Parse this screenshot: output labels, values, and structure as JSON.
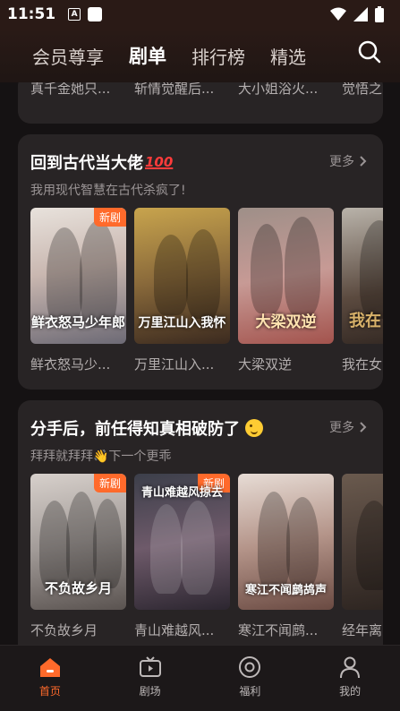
{
  "status_bar": {
    "time": "11:51"
  },
  "top_nav": {
    "tabs": [
      {
        "label": "会员尊享",
        "active": false
      },
      {
        "label": "剧单",
        "active": true
      },
      {
        "label": "排行榜",
        "active": false
      },
      {
        "label": "精选",
        "active": false
      }
    ]
  },
  "partial_row": {
    "titles": [
      "真千金她只...",
      "斩情觉醒后...",
      "大小姐浴火...",
      "觉悟之"
    ]
  },
  "sections": [
    {
      "title": "回到古代当大佬",
      "title_emoji": "100",
      "more_label": "更多",
      "subtitle": "我用现代智慧在古代杀疯了!",
      "items": [
        {
          "title": "鲜衣怒马少...",
          "badge": "新剧",
          "art_text": "鲜衣怒马少年郎"
        },
        {
          "title": "万里江山入...",
          "badge": "",
          "art_text": "万里江山入我怀"
        },
        {
          "title": "大梁双逆",
          "badge": "",
          "art_text": "大梁双逆"
        },
        {
          "title": "我在女",
          "badge": "",
          "art_text": "我在"
        }
      ]
    },
    {
      "title": "分手后，前任得知真相破防了",
      "title_emoji": "wink",
      "more_label": "更多",
      "subtitle": "拜拜就拜拜👋下一个更乖",
      "items": [
        {
          "title": "不负故乡月",
          "badge": "新剧",
          "art_text": "不负故乡月"
        },
        {
          "title": "青山难越风...",
          "badge": "新剧",
          "art_text": "青山难越风掠去"
        },
        {
          "title": "寒江不闻鹧...",
          "badge": "",
          "art_text": "寒江不闻鹧鸪声"
        },
        {
          "title": "经年离",
          "badge": "",
          "art_text": ""
        }
      ]
    }
  ],
  "tab_bar": {
    "items": [
      {
        "label": "首页",
        "icon": "home-icon",
        "active": true
      },
      {
        "label": "剧场",
        "icon": "tv-icon",
        "active": false
      },
      {
        "label": "福利",
        "icon": "welfare-icon",
        "active": false
      },
      {
        "label": "我的",
        "icon": "profile-icon",
        "active": false
      }
    ]
  },
  "colors": {
    "accent": "#ff6a2b",
    "card_bg": "#282425",
    "page_bg": "#151213"
  }
}
